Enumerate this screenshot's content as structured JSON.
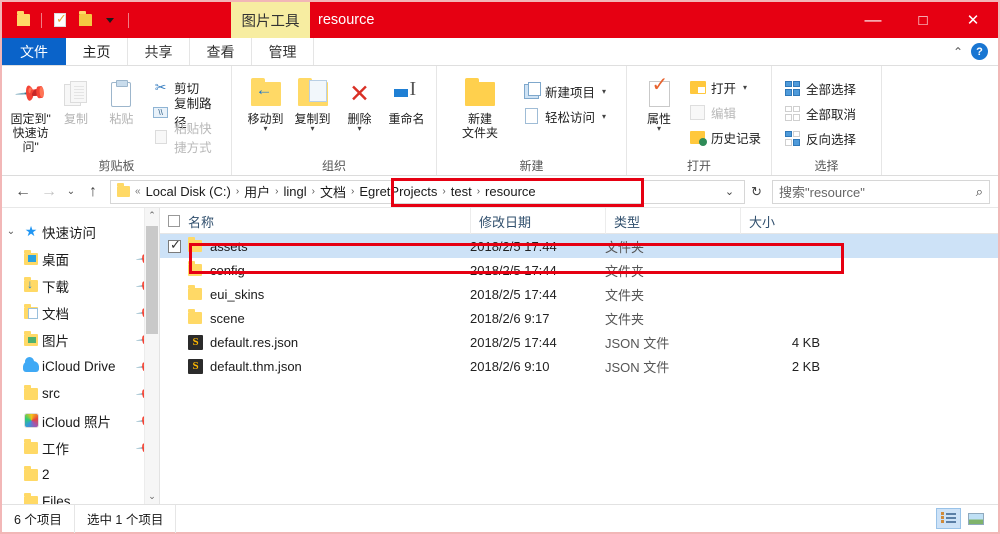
{
  "titlebar": {
    "quick_access": [
      {
        "name": "folder-icon",
        "label": ""
      },
      {
        "name": "properties-icon",
        "label": ""
      },
      {
        "name": "new-folder-icon",
        "label": ""
      },
      {
        "name": "customize-dropdown-icon",
        "label": ""
      }
    ],
    "contextual_tab": "图片工具",
    "window_title": "resource",
    "minimize": "—",
    "maximize": "□",
    "close": "✕"
  },
  "tabs": [
    {
      "label": "文件",
      "kind": "file"
    },
    {
      "label": "主页",
      "kind": "active"
    },
    {
      "label": "共享",
      "kind": "normal"
    },
    {
      "label": "查看",
      "kind": "normal"
    },
    {
      "label": "管理",
      "kind": "normal"
    }
  ],
  "ribbon_controls": {
    "collapse": "⌃",
    "help": "?"
  },
  "ribbon": {
    "clipboard": {
      "label": "剪贴板",
      "pin_line1": "固定到\"",
      "pin_line2": "快速访问\"",
      "copy": "复制",
      "paste": "粘贴",
      "cut": "剪切",
      "copy_path": "复制路径",
      "paste_shortcut": "粘贴快捷方式"
    },
    "organize": {
      "label": "组织",
      "move_to": "移动到",
      "copy_to": "复制到",
      "delete": "删除",
      "rename": "重命名"
    },
    "new": {
      "label": "新建",
      "new_folder_line1": "新建",
      "new_folder_line2": "文件夹",
      "new_item": "新建项目",
      "easy_access": "轻松访问"
    },
    "open": {
      "label": "打开",
      "properties": "属性",
      "open": "打开",
      "edit": "编辑",
      "history": "历史记录"
    },
    "select": {
      "label": "选择",
      "select_all": "全部选择",
      "select_none": "全部取消",
      "invert_selection": "反向选择"
    }
  },
  "address": {
    "back": "←",
    "forward": "→",
    "recent": "⌄",
    "up": "↑",
    "crumbs": [
      "Local Disk (C:)",
      "用户",
      "lingl",
      "文档",
      "EgretProjects",
      "test",
      "resource"
    ],
    "overflow": "«",
    "dropdown": "⌄",
    "refresh": "↻",
    "search_placeholder": "搜索\"resource\"",
    "search_icon": "⌕"
  },
  "sidebar": {
    "items": [
      {
        "label": "快速访问",
        "icon": "star-icon",
        "expander": "⌄",
        "pinned": false,
        "child": false
      },
      {
        "label": "桌面",
        "icon": "desktop-folder-icon",
        "pinned": true,
        "child": true
      },
      {
        "label": "下载",
        "icon": "downloads-folder-icon",
        "pinned": true,
        "child": true
      },
      {
        "label": "文档",
        "icon": "documents-folder-icon",
        "pinned": true,
        "child": true
      },
      {
        "label": "图片",
        "icon": "pictures-folder-icon",
        "pinned": true,
        "child": true
      },
      {
        "label": "iCloud Drive",
        "icon": "cloud-icon",
        "pinned": true,
        "child": true
      },
      {
        "label": "src",
        "icon": "folder-icon",
        "pinned": true,
        "child": true
      },
      {
        "label": "iCloud 照片",
        "icon": "photos-icon",
        "pinned": true,
        "child": true
      },
      {
        "label": "工作",
        "icon": "folder-icon",
        "pinned": true,
        "child": true
      },
      {
        "label": "2",
        "icon": "folder-icon",
        "pinned": false,
        "child": true
      },
      {
        "label": "Files",
        "icon": "folder-icon",
        "pinned": false,
        "child": true
      }
    ],
    "scroll_up": "⌃",
    "scroll_down": "⌄"
  },
  "filelist": {
    "columns": [
      "名称",
      "修改日期",
      "类型",
      "大小"
    ],
    "rows": [
      {
        "name": "assets",
        "date": "2018/2/5 17:44",
        "type": "文件夹",
        "size": "",
        "icon": "folder-icon",
        "selected": true,
        "checked": true
      },
      {
        "name": "config",
        "date": "2018/2/5 17:44",
        "type": "文件夹",
        "size": "",
        "icon": "folder-icon",
        "selected": false,
        "checked": false
      },
      {
        "name": "eui_skins",
        "date": "2018/2/5 17:44",
        "type": "文件夹",
        "size": "",
        "icon": "folder-icon",
        "selected": false,
        "checked": false
      },
      {
        "name": "scene",
        "date": "2018/2/6 9:17",
        "type": "文件夹",
        "size": "",
        "icon": "folder-icon",
        "selected": false,
        "checked": false
      },
      {
        "name": "default.res.json",
        "date": "2018/2/5 17:44",
        "type": "JSON 文件",
        "size": "4 KB",
        "icon": "json-file-icon",
        "selected": false,
        "checked": false
      },
      {
        "name": "default.thm.json",
        "date": "2018/2/6 9:10",
        "type": "JSON 文件",
        "size": "2 KB",
        "icon": "json-file-icon",
        "selected": false,
        "checked": false
      }
    ]
  },
  "statusbar": {
    "item_count": "6 个项目",
    "selection": "选中 1 个项目",
    "details_view": "details-view-icon",
    "thumbnail_view": "thumbnail-view-icon"
  },
  "annotations": {
    "accent_color": "#e60012",
    "selection_color": "#cde2f7",
    "highlight_color": "#f7eda1"
  }
}
